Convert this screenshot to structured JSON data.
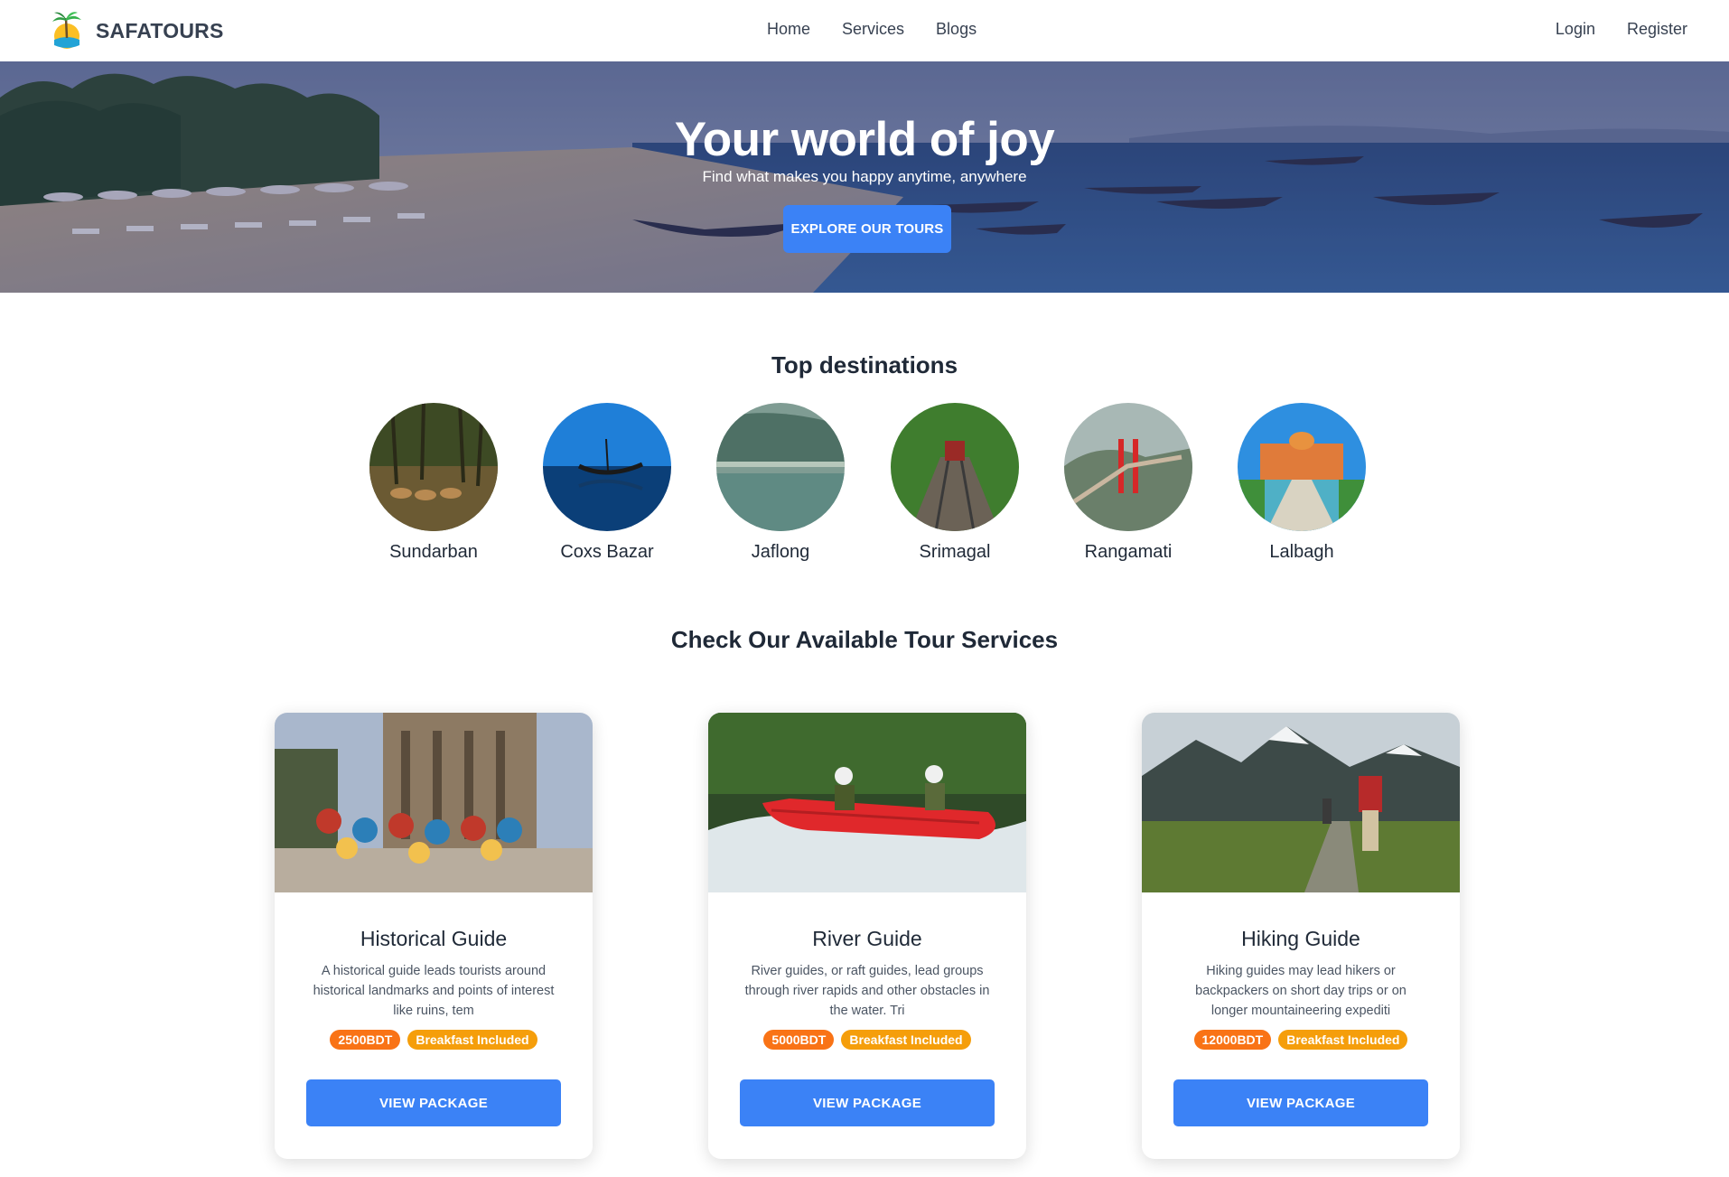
{
  "nav": {
    "brand": "SAFATOURS",
    "links": [
      "Home",
      "Services",
      "Blogs"
    ],
    "auth": [
      "Login",
      "Register"
    ]
  },
  "hero": {
    "title": "Your world of joy",
    "subtitle": "Find what makes you happy anytime, anywhere",
    "cta": "EXPLORE OUR TOURS"
  },
  "destinations": {
    "title": "Top destinations",
    "items": [
      "Sundarban",
      "Coxs Bazar",
      "Jaflong",
      "Srimagal",
      "Rangamati",
      "Lalbagh"
    ]
  },
  "services": {
    "title": "Check Our Available Tour Services",
    "cards": [
      {
        "title": "Historical Guide",
        "description": "A historical guide leads tourists around historical landmarks and points of interest like ruins, tem",
        "price": "2500BDT",
        "extra": "Breakfast Included",
        "button": "VIEW PACKAGE"
      },
      {
        "title": "River Guide",
        "description": "River guides, or raft guides, lead groups through river rapids and other obstacles in the water. Tri",
        "price": "5000BDT",
        "extra": "Breakfast Included",
        "button": "VIEW PACKAGE"
      },
      {
        "title": "Hiking Guide",
        "description": "Hiking guides may lead hikers or backpackers on short day trips or on longer mountaineering expediti",
        "price": "12000BDT",
        "extra": "Breakfast Included",
        "button": "VIEW PACKAGE"
      }
    ]
  },
  "colors": {
    "primary": "#3b82f6",
    "price_badge": "#f97316",
    "extra_badge": "#f59e0b"
  }
}
